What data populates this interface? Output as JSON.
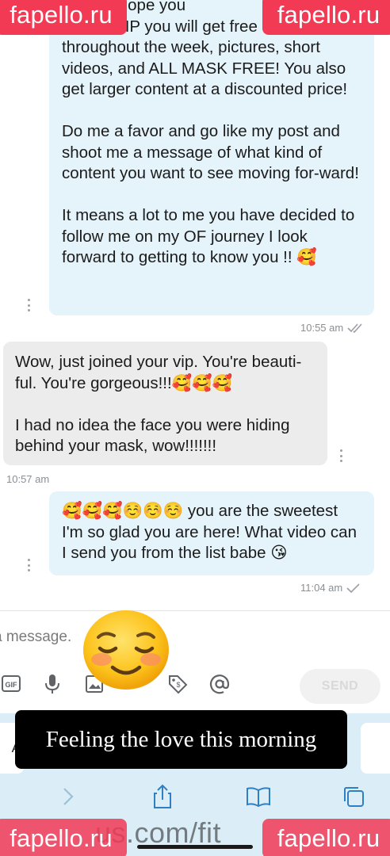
{
  "watermark": {
    "text": "fapello.ru",
    "color": "#f23a55"
  },
  "conversation": {
    "messages": [
      {
        "direction": "outgoing",
        "text": "mask, I hope you\nOn my VIP you will get free content throughout the week, pictures, short videos, and ALL MASK FREE! You also get larger content at a discounted price!\n\nDo me a favor and go like my post and shoot me a message of what kind of content you want to see moving for-ward!\n\nIt means a lot to me you have decided to follow me on my OF journey I look forward to getting to know you !! 🥰",
        "time": "10:55 am",
        "status": "read"
      },
      {
        "direction": "incoming",
        "text": "Wow, just joined your vip. You're beauti-ful. You're gorgeous!!!🥰🥰🥰\n\nI had no idea the face you were hiding behind your mask, wow!!!!!!!",
        "time": "10:57 am"
      },
      {
        "direction": "outgoing",
        "text": "🥰🥰🥰☺️☺️☺️ you are the sweetest I'm so glad you are here! What video can I send you from the list babe 😘",
        "time": "11:04 am",
        "status": "sent"
      }
    ]
  },
  "composer": {
    "placeholder": "a message.",
    "send_label": "SEND",
    "gif_label": "GIF",
    "tools": [
      "gif-icon",
      "microphone-icon",
      "image-icon",
      "price-tag-icon",
      "at-sign-icon"
    ]
  },
  "overlay": {
    "caption": "Feeling the love this morning",
    "sticker": "smiling-face-icon"
  },
  "browser": {
    "tab_left_label": "A",
    "url_fragment": "us.com/fit",
    "nav_icons": [
      "forward-icon",
      "share-icon",
      "bookmarks-icon",
      "tabs-icon"
    ]
  }
}
